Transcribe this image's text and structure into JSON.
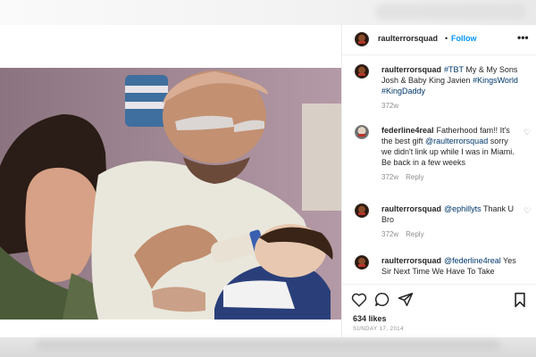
{
  "post": {
    "author": "raulterrorsquad",
    "separator": "•",
    "follow_label": "Follow",
    "more_icon": "more-horizontal-icon",
    "caption": {
      "user": "raulterrorsquad",
      "text_parts": [
        "#TBT",
        " My & My Sons Josh & Baby King Javien ",
        "#KingsWorld",
        " ",
        "#KingDaddy"
      ],
      "time": "372w"
    },
    "comments": [
      {
        "user": "federline4real",
        "text_before": "Fatherhood fam!! It's the best gift ",
        "mention": "@raulterrorsquad",
        "text_after": " sorry we didn't link up while I was in Miami. Be back in a few weeks",
        "time": "372w",
        "reply": "Reply"
      },
      {
        "user": "raulterrorsquad",
        "mention": "@ephillyts",
        "text_after": " Thank U Bro",
        "time": "372w",
        "reply": "Reply"
      },
      {
        "user": "raulterrorsquad",
        "mention": "@federline4real",
        "text_after": " Yes Sir Next Time We Have To Take"
      }
    ],
    "likes": "634 likes",
    "date": "SUNDAY 17, 2014",
    "icons": {
      "like": "heart-icon",
      "comment": "comment-icon",
      "share": "share-icon",
      "save": "bookmark-icon"
    },
    "colors": {
      "link": "#00376b",
      "follow": "#0095f6",
      "meta": "#8e8e8e"
    }
  }
}
